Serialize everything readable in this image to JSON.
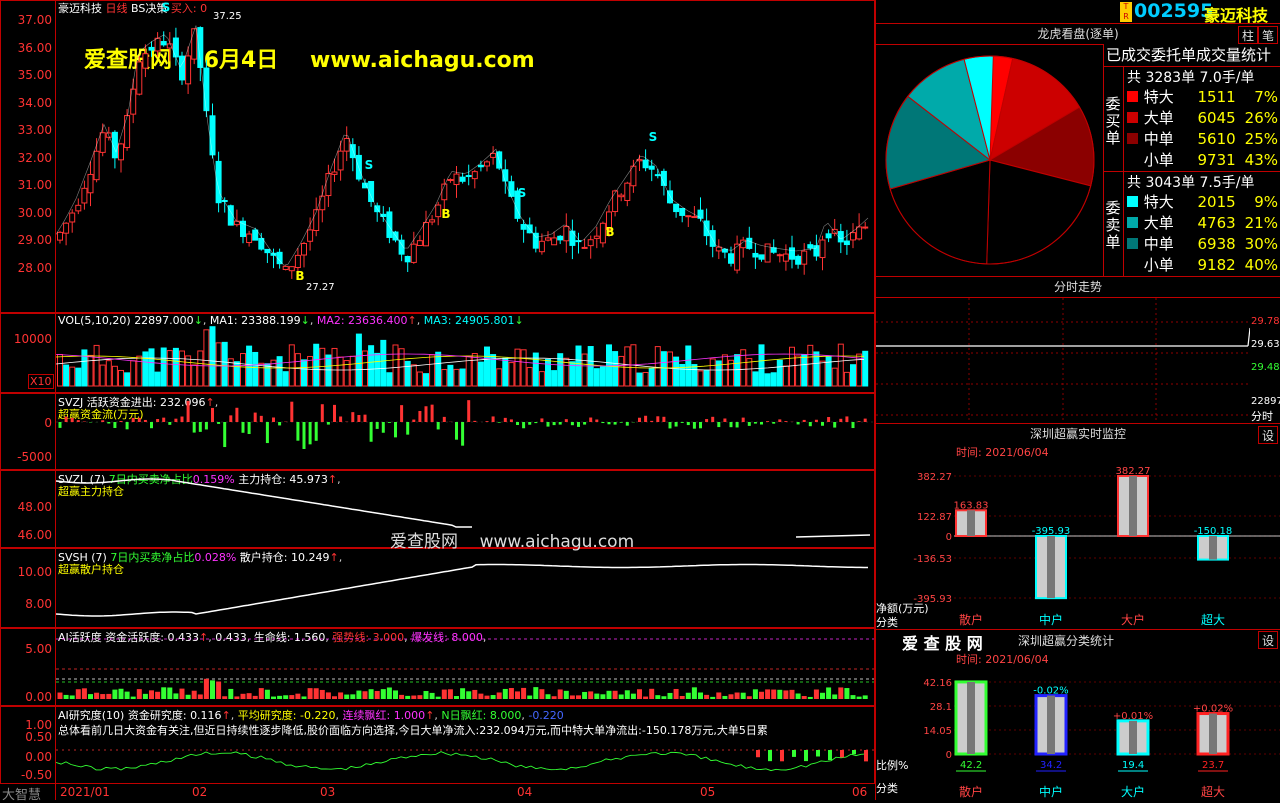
{
  "header": {
    "stock_name": "豪迈科技",
    "period": "日线",
    "strategy": "BS决策",
    "buy_label": "买入:",
    "buy_value": "0"
  },
  "watermark": {
    "site": "爱查股网",
    "date": "6月4日",
    "url": "www.aichagu.com"
  },
  "center_watermark": "爱查股网    www.aichagu.com",
  "price_axis": [
    "37.00",
    "36.00",
    "35.00",
    "34.00",
    "33.00",
    "32.00",
    "31.00",
    "30.00",
    "29.00",
    "28.00"
  ],
  "price_marks": {
    "high": "37.25",
    "low": "27.27",
    "buy_mark": "B",
    "sell_mark": "S"
  },
  "vol": {
    "title": "VOL(5,10,20)",
    "value": "22897.000",
    "ma1": "MA1: 23388.199",
    "ma2": "MA2: 23636.400",
    "ma3": "MA3: 24905.801",
    "axis": "10000",
    "unit": "X10"
  },
  "svzj": {
    "name": "SVZJ",
    "label1": "活跃资金进出:",
    "value1": "232.096",
    "label2": "超赢资金流(万元)",
    "axis": [
      "0",
      "-5000"
    ]
  },
  "svzl": {
    "name": "SVZL (7)",
    "label1": "7日内买卖净占比",
    "value1": "0.159%",
    "label2": "主力持仓:",
    "value2": "45.973",
    "label3": "超赢主力持仓",
    "axis": [
      "48.00",
      "46.00"
    ]
  },
  "svsh": {
    "name": "SVSH (7)",
    "label1": "7日内买卖净占比",
    "value1": "0.028%",
    "label2": "散户持仓:",
    "value2": "10.249",
    "label3": "超赢散户持仓",
    "axis": [
      "10.00",
      "8.00"
    ]
  },
  "ai_act": {
    "text1": "AI活跃度 资金活跃度:",
    "v1": "0.433",
    "v2": "0.433",
    "text2": "生命线:",
    "v3": "1.560",
    "strong": "强势线: 3.000",
    "burst": "爆发线: 8.000",
    "axis": [
      "5.00",
      "0.00"
    ]
  },
  "ai_res": {
    "text1": "AI研究度(10) 资金研究度:",
    "v1": "0.116",
    "text2": "平均研究度:",
    "v2": "-0.220",
    "text3": "连续飘红:",
    "v3": "1.000",
    "text4": "N日飘红:",
    "v4": "8.000",
    "v5": "-0.220",
    "summary": "总体看前几日大资金有关注,但近日持续性逐步降低,股价面临方向选择,今日大单净流入:232.094万元,而中特大单净流出:-150.178万元,大单5日累",
    "axis": [
      "1.00",
      "0.50",
      "0.00",
      "-0.50"
    ]
  },
  "xaxis": {
    "brand": "大智慧",
    "labels": [
      "2021/01",
      "02",
      "03",
      "04",
      "05",
      "06"
    ]
  },
  "right_header": {
    "badge": "T R",
    "code": "002595",
    "name": "豪迈科技",
    "btn1": "柱",
    "btn2": "笔"
  },
  "pie_panel": {
    "title": "龙虎看盘(逐单)",
    "subtitle": "已成交委托单成交量统计",
    "buy": {
      "side_label": "委买单",
      "summary": "共 3283单 7.0手/单",
      "rows": [
        {
          "label": "特大",
          "count": "1511",
          "pct": "7%"
        },
        {
          "label": "大单",
          "count": "6045",
          "pct": "26%"
        },
        {
          "label": "中单",
          "count": "5610",
          "pct": "25%"
        },
        {
          "label": "小单",
          "count": "9731",
          "pct": "43%"
        }
      ]
    },
    "sell": {
      "side_label": "委卖单",
      "summary": "共 3043单 7.5手/单",
      "rows": [
        {
          "label": "特大",
          "count": "2015",
          "pct": "9%"
        },
        {
          "label": "大单",
          "count": "4763",
          "pct": "21%"
        },
        {
          "label": "中单",
          "count": "6938",
          "pct": "30%"
        },
        {
          "label": "小单",
          "count": "9182",
          "pct": "40%"
        }
      ]
    },
    "colors": {
      "buy": [
        "#ff0000",
        "#cc0000",
        "#8b0000",
        "#000000"
      ],
      "sell": [
        "#00ffff",
        "#00aaaa",
        "#007777",
        "#000000"
      ]
    }
  },
  "intraday": {
    "title": "分时走势",
    "axis": [
      "29.78",
      "29.63",
      "29.48"
    ],
    "vol": "22897",
    "unit": "分时"
  },
  "monitor": {
    "title": "深圳超赢实时监控",
    "set": "设",
    "time": "时间: 2021/06/04",
    "unit": "净额(万元)",
    "cat": "分类",
    "axis": [
      "382.27",
      "122.87",
      "0",
      "-136.53",
      "-395.93"
    ],
    "bars": [
      {
        "name": "散户",
        "value": "163.83"
      },
      {
        "name": "中户",
        "value": "-395.93"
      },
      {
        "name": "大户",
        "value": "382.27"
      },
      {
        "name": "超大",
        "value": "-150.18"
      }
    ]
  },
  "classify": {
    "brand": "爱 查 股 网",
    "title": "深圳超赢分类统计",
    "set": "设",
    "time": "时间: 2021/06/04",
    "ratio": "比例%",
    "cat": "分类",
    "axis": [
      "42.16",
      "28.1",
      "14.05",
      "0"
    ],
    "bars": [
      {
        "name": "散户",
        "value": "42.2",
        "change": ""
      },
      {
        "name": "中户",
        "value": "34.2",
        "change": "-0.02%"
      },
      {
        "name": "大户",
        "value": "19.4",
        "change": "+0.01%"
      },
      {
        "name": "超大",
        "value": "23.7",
        "change": "+0.02%"
      }
    ]
  }
}
